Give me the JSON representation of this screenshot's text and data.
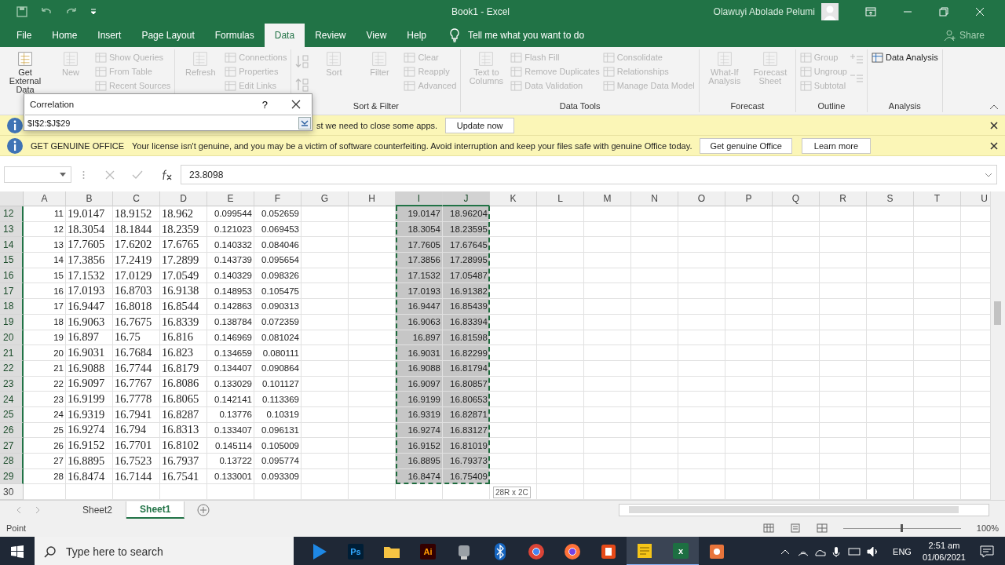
{
  "title_bar": {
    "title": "Book1  -  Excel",
    "user": "Olawuyi Abolade Pelumi"
  },
  "ribbon_tabs": [
    {
      "label": "File",
      "selected": false
    },
    {
      "label": "Home",
      "selected": false
    },
    {
      "label": "Insert",
      "selected": false
    },
    {
      "label": "Page Layout",
      "selected": false
    },
    {
      "label": "Formulas",
      "selected": false
    },
    {
      "label": "Data",
      "selected": true
    },
    {
      "label": "Review",
      "selected": false
    },
    {
      "label": "View",
      "selected": false
    },
    {
      "label": "Help",
      "selected": false
    }
  ],
  "tell_me": "Tell me what you want to do",
  "share": "Share",
  "ribbon_groups": [
    {
      "columns": [
        {
          "kind": "large",
          "label": "Get External Data",
          "disabled": false
        },
        {
          "kind": "large",
          "label": "New",
          "disabled": true
        },
        {
          "kind": "stack",
          "items": [
            {
              "label": "Show Queries",
              "disabled": true
            },
            {
              "label": "From Table",
              "disabled": true
            },
            {
              "label": "Recent Sources",
              "disabled": true
            }
          ]
        }
      ]
    },
    {
      "columns": [
        {
          "kind": "large",
          "label": "Refresh",
          "disabled": true
        },
        {
          "kind": "stack",
          "items": [
            {
              "label": "Connections",
              "disabled": true
            },
            {
              "label": "Properties",
              "disabled": true
            },
            {
              "label": "Edit Links",
              "disabled": true
            }
          ]
        }
      ]
    },
    {
      "label": "Sort & Filter",
      "columns": [
        {
          "kind": "sort_icons"
        },
        {
          "kind": "large",
          "label": "Sort",
          "disabled": true
        },
        {
          "kind": "large",
          "label": "Filter",
          "disabled": true
        },
        {
          "kind": "stack",
          "items": [
            {
              "label": "Clear",
              "disabled": true
            },
            {
              "label": "Reapply",
              "disabled": true
            },
            {
              "label": "Advanced",
              "disabled": true
            }
          ]
        }
      ]
    },
    {
      "label": "Data Tools",
      "columns": [
        {
          "kind": "large",
          "label": "Text to Columns",
          "disabled": true
        },
        {
          "kind": "stack",
          "items": [
            {
              "label": "Flash Fill",
              "disabled": true
            },
            {
              "label": "Remove Duplicates",
              "disabled": true
            },
            {
              "label": "Data Validation",
              "disabled": true
            }
          ]
        },
        {
          "kind": "stack",
          "items": [
            {
              "label": "Consolidate",
              "disabled": true
            },
            {
              "label": "Relationships",
              "disabled": true
            },
            {
              "label": "Manage Data Model",
              "disabled": true
            }
          ]
        }
      ]
    },
    {
      "label": "Forecast",
      "columns": [
        {
          "kind": "large",
          "label": "What-If Analysis",
          "disabled": true
        },
        {
          "kind": "large",
          "label": "Forecast Sheet",
          "disabled": true
        }
      ]
    },
    {
      "label": "Outline",
      "columns": [
        {
          "kind": "stack",
          "items": [
            {
              "label": "Group",
              "disabled": true
            },
            {
              "label": "Ungroup",
              "disabled": true
            },
            {
              "label": "Subtotal",
              "disabled": true
            }
          ]
        },
        {
          "kind": "outline_icons"
        }
      ]
    },
    {
      "label": "Analysis",
      "columns": [
        {
          "kind": "stack",
          "items": [
            {
              "label": "Data Analysis",
              "disabled": false
            }
          ]
        }
      ]
    }
  ],
  "dialog": {
    "title": "Correlation",
    "help": "?",
    "value": "$I$2:$J$29"
  },
  "info_bars": [
    {
      "message": "st we need to close some apps.",
      "buttons": [
        "Update now"
      ]
    },
    {
      "title": "GET GENUINE OFFICE",
      "message": "Your license isn't genuine, and you may be a victim of software counterfeiting. Avoid interruption and keep your files safe with genuine Office today.",
      "buttons": [
        "Get genuine Office",
        "Learn more"
      ]
    }
  ],
  "formula_bar": {
    "value": "23.8098"
  },
  "columns": [
    {
      "label": "A",
      "selected": false
    },
    {
      "label": "B",
      "selected": false
    },
    {
      "label": "C",
      "selected": false
    },
    {
      "label": "D",
      "selected": false
    },
    {
      "label": "E",
      "selected": false
    },
    {
      "label": "F",
      "selected": false
    },
    {
      "label": "G",
      "selected": false
    },
    {
      "label": "H",
      "selected": false
    },
    {
      "label": "I",
      "selected": true
    },
    {
      "label": "J",
      "selected": true
    },
    {
      "label": "K",
      "selected": false
    },
    {
      "label": "L",
      "selected": false
    },
    {
      "label": "M",
      "selected": false
    },
    {
      "label": "N",
      "selected": false
    },
    {
      "label": "O",
      "selected": false
    },
    {
      "label": "P",
      "selected": false
    },
    {
      "label": "Q",
      "selected": false
    },
    {
      "label": "R",
      "selected": false
    },
    {
      "label": "S",
      "selected": false
    },
    {
      "label": "T",
      "selected": false
    },
    {
      "label": "U",
      "selected": false
    }
  ],
  "rows": [
    {
      "row": "12",
      "selected": true,
      "cells": [
        "11",
        "19.0147",
        "18.9152",
        "18.962",
        "0.099544",
        "0.052659"
      ],
      "copied": [
        "19.0147",
        "18.96204"
      ]
    },
    {
      "row": "13",
      "selected": true,
      "cells": [
        "12",
        "18.3054",
        "18.1844",
        "18.2359",
        "0.121023",
        "0.069453"
      ],
      "copied": [
        "18.3054",
        "18.23595"
      ]
    },
    {
      "row": "14",
      "selected": true,
      "cells": [
        "13",
        "17.7605",
        "17.6202",
        "17.6765",
        "0.140332",
        "0.084046"
      ],
      "copied": [
        "17.7605",
        "17.67645"
      ]
    },
    {
      "row": "15",
      "selected": true,
      "cells": [
        "14",
        "17.3856",
        "17.2419",
        "17.2899",
        "0.143739",
        "0.095654"
      ],
      "copied": [
        "17.3856",
        "17.28995"
      ]
    },
    {
      "row": "16",
      "selected": true,
      "cells": [
        "15",
        "17.1532",
        "17.0129",
        "17.0549",
        "0.140329",
        "0.098326"
      ],
      "copied": [
        "17.1532",
        "17.05487"
      ]
    },
    {
      "row": "17",
      "selected": true,
      "cells": [
        "16",
        "17.0193",
        "16.8703",
        "16.9138",
        "0.148953",
        "0.105475"
      ],
      "copied": [
        "17.0193",
        "16.91382"
      ]
    },
    {
      "row": "18",
      "selected": true,
      "cells": [
        "17",
        "16.9447",
        "16.8018",
        "16.8544",
        "0.142863",
        "0.090313"
      ],
      "copied": [
        "16.9447",
        "16.85439"
      ]
    },
    {
      "row": "19",
      "selected": true,
      "cells": [
        "18",
        "16.9063",
        "16.7675",
        "16.8339",
        "0.138784",
        "0.072359"
      ],
      "copied": [
        "16.9063",
        "16.83394"
      ]
    },
    {
      "row": "20",
      "selected": true,
      "cells": [
        "19",
        "16.897",
        "16.75",
        "16.816",
        "0.146969",
        "0.081024"
      ],
      "copied": [
        "16.897",
        "16.81598"
      ]
    },
    {
      "row": "21",
      "selected": true,
      "cells": [
        "20",
        "16.9031",
        "16.7684",
        "16.823",
        "0.134659",
        "0.080111"
      ],
      "copied": [
        "16.9031",
        "16.82299"
      ]
    },
    {
      "row": "22",
      "selected": true,
      "cells": [
        "21",
        "16.9088",
        "16.7744",
        "16.8179",
        "0.134407",
        "0.090864"
      ],
      "copied": [
        "16.9088",
        "16.81794"
      ]
    },
    {
      "row": "23",
      "selected": true,
      "cells": [
        "22",
        "16.9097",
        "16.7767",
        "16.8086",
        "0.133029",
        "0.101127"
      ],
      "copied": [
        "16.9097",
        "16.80857"
      ]
    },
    {
      "row": "24",
      "selected": true,
      "cells": [
        "23",
        "16.9199",
        "16.7778",
        "16.8065",
        "0.142141",
        "0.113369"
      ],
      "copied": [
        "16.9199",
        "16.80653"
      ]
    },
    {
      "row": "25",
      "selected": true,
      "cells": [
        "24",
        "16.9319",
        "16.7941",
        "16.8287",
        "0.13776",
        "0.10319"
      ],
      "copied": [
        "16.9319",
        "16.82871"
      ]
    },
    {
      "row": "26",
      "selected": true,
      "cells": [
        "25",
        "16.9274",
        "16.794",
        "16.8313",
        "0.133407",
        "0.096131"
      ],
      "copied": [
        "16.9274",
        "16.83127"
      ]
    },
    {
      "row": "27",
      "selected": true,
      "cells": [
        "26",
        "16.9152",
        "16.7701",
        "16.8102",
        "0.145114",
        "0.105009"
      ],
      "copied": [
        "16.9152",
        "16.81019"
      ]
    },
    {
      "row": "28",
      "selected": true,
      "cells": [
        "27",
        "16.8895",
        "16.7523",
        "16.7937",
        "0.13722",
        "0.095774"
      ],
      "copied": [
        "16.8895",
        "16.79373"
      ]
    },
    {
      "row": "29",
      "selected": true,
      "cells": [
        "28",
        "16.8474",
        "16.7144",
        "16.7541",
        "0.133001",
        "0.093309"
      ],
      "copied": [
        "16.8474",
        "16.75409"
      ]
    },
    {
      "row": "30",
      "selected": false
    }
  ],
  "selection_tip": "28R x 2C",
  "sheet_tabs": [
    {
      "label": "Sheet2",
      "selected": false
    },
    {
      "label": "Sheet1",
      "selected": true
    }
  ],
  "status_bar": {
    "mode": "Point",
    "zoom": "100%",
    "level": 0.5
  },
  "taskbar": {
    "search": "Type here to search",
    "apps": [
      {
        "kind": "play"
      },
      {
        "kind": "ps",
        "label": "Ps"
      },
      {
        "kind": "folder"
      },
      {
        "kind": "ai",
        "label": "Ai"
      },
      {
        "kind": "tool"
      },
      {
        "kind": "bluetooth"
      },
      {
        "kind": "chrome"
      },
      {
        "kind": "firefox"
      },
      {
        "kind": "office"
      },
      {
        "kind": "note"
      },
      {
        "kind": "excel",
        "label": "x"
      },
      {
        "kind": "record"
      }
    ],
    "language": "ENG",
    "time": "2:51 am",
    "date": "01/06/2021"
  }
}
